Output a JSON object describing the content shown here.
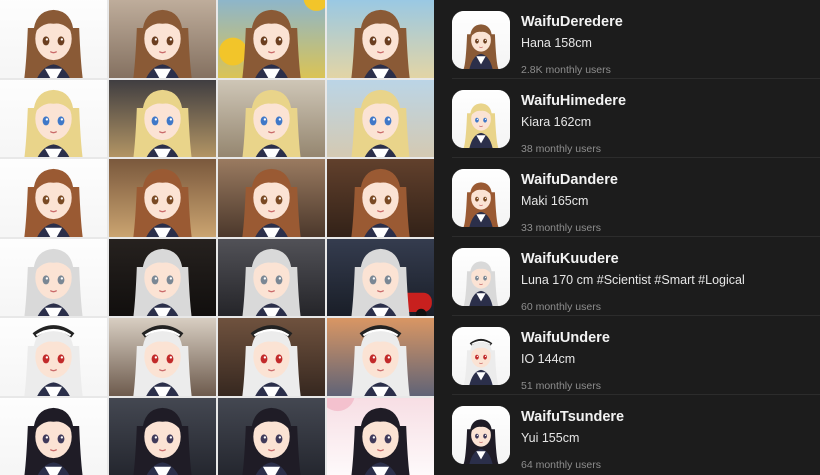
{
  "colors": {
    "background": "#1c1c1c",
    "title_text": "#f2f2f2",
    "muted_text": "#8e8e8e"
  },
  "gallery": {
    "rows": [
      {
        "character": "Hana",
        "hair": "#8a5a36",
        "eyes": "#6b3e1f",
        "scenes": [
          "white",
          "room",
          "outdoor-yellow",
          "beach"
        ]
      },
      {
        "character": "Kiara",
        "hair": "#e9d48a",
        "eyes": "#3f78c8",
        "scenes": [
          "white",
          "dark-window",
          "desk",
          "castle"
        ]
      },
      {
        "character": "Maki",
        "hair": "#9a5a33",
        "eyes": "#7a4a24",
        "scenes": [
          "white",
          "kitchen",
          "warm-room",
          "library"
        ]
      },
      {
        "character": "Luna",
        "hair": "#d9d9d9",
        "eyes": "#7a8794",
        "scenes": [
          "white",
          "bar",
          "office",
          "car-night"
        ]
      },
      {
        "character": "IO",
        "hair": "#ececec",
        "eyes": "#c22a2a",
        "scenes": [
          "white",
          "cafe",
          "hall",
          "sunset"
        ]
      },
      {
        "character": "Yui",
        "hair": "#1f1c26",
        "eyes": "#403a5a",
        "scenes": [
          "white",
          "train",
          "train",
          "sakura"
        ]
      }
    ]
  },
  "list": {
    "items": [
      {
        "name": "WaifuDeredere",
        "desc": "Hana 158cm",
        "users": "2.8K monthly users",
        "hair": "#8a5a36",
        "eyes": "#6b3e1f",
        "accessory": "none"
      },
      {
        "name": "WaifuHimedere",
        "desc": "Kiara 162cm",
        "users": "38 monthly users",
        "hair": "#e9d48a",
        "eyes": "#3f78c8",
        "accessory": "none"
      },
      {
        "name": "WaifuDandere",
        "desc": "Maki 165cm",
        "users": "33 monthly users",
        "hair": "#9a5a33",
        "eyes": "#7a4a24",
        "accessory": "none"
      },
      {
        "name": "WaifuKuudere",
        "desc": "Luna 170 cm #Scientist #Smart #Logical",
        "users": "60 monthly users",
        "hair": "#d9d9d9",
        "eyes": "#7a8794",
        "accessory": "none"
      },
      {
        "name": "WaifuUndere",
        "desc": "IO 144cm",
        "users": "51 monthly users",
        "hair": "#ececec",
        "eyes": "#c22a2a",
        "accessory": "headband"
      },
      {
        "name": "WaifuTsundere",
        "desc": "Yui 155cm",
        "users": "64 monthly users",
        "hair": "#1f1c26",
        "eyes": "#403a5a",
        "accessory": "none"
      }
    ]
  }
}
